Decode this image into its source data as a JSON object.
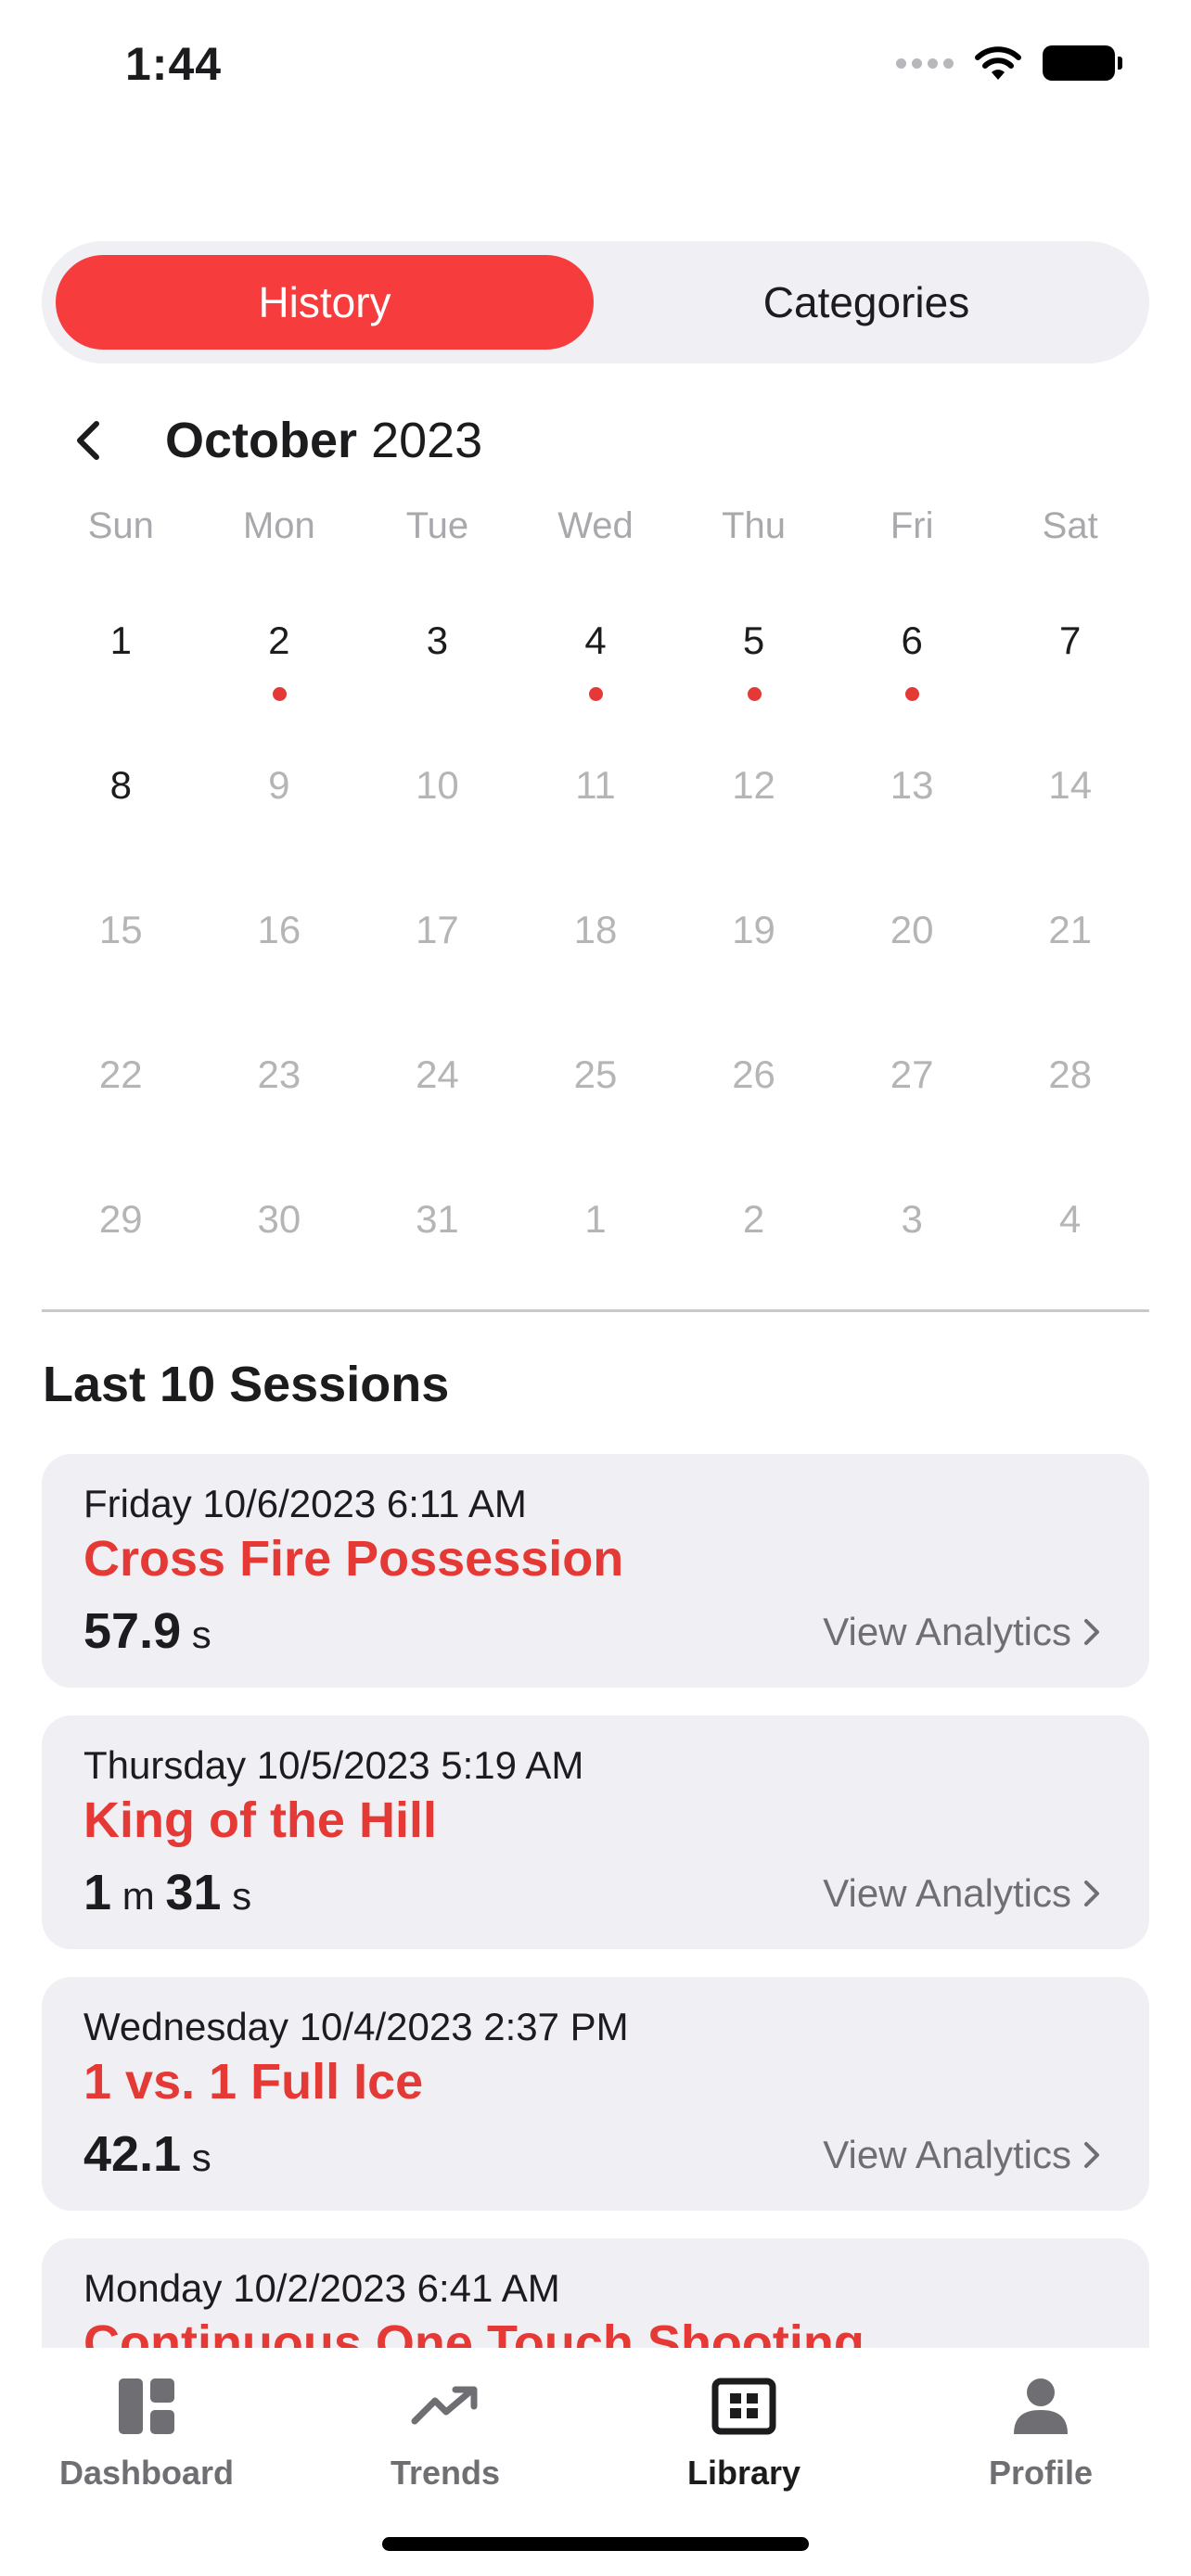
{
  "status_bar": {
    "time": "1:44"
  },
  "segmented": {
    "history_label": "History",
    "categories_label": "Categories",
    "selected": "History"
  },
  "calendar": {
    "month": "October",
    "year": "2023",
    "weekdays": [
      "Sun",
      "Mon",
      "Tue",
      "Wed",
      "Thu",
      "Fri",
      "Sat"
    ],
    "weeks": [
      [
        {
          "d": "1",
          "muted": false,
          "dot": false
        },
        {
          "d": "2",
          "muted": false,
          "dot": true
        },
        {
          "d": "3",
          "muted": false,
          "dot": false
        },
        {
          "d": "4",
          "muted": false,
          "dot": true
        },
        {
          "d": "5",
          "muted": false,
          "dot": true
        },
        {
          "d": "6",
          "muted": false,
          "dot": true
        },
        {
          "d": "7",
          "muted": false,
          "dot": false
        }
      ],
      [
        {
          "d": "8",
          "muted": false,
          "dot": false
        },
        {
          "d": "9",
          "muted": true,
          "dot": false
        },
        {
          "d": "10",
          "muted": true,
          "dot": false
        },
        {
          "d": "11",
          "muted": true,
          "dot": false
        },
        {
          "d": "12",
          "muted": true,
          "dot": false
        },
        {
          "d": "13",
          "muted": true,
          "dot": false
        },
        {
          "d": "14",
          "muted": true,
          "dot": false
        }
      ],
      [
        {
          "d": "15",
          "muted": true,
          "dot": false
        },
        {
          "d": "16",
          "muted": true,
          "dot": false
        },
        {
          "d": "17",
          "muted": true,
          "dot": false
        },
        {
          "d": "18",
          "muted": true,
          "dot": false
        },
        {
          "d": "19",
          "muted": true,
          "dot": false
        },
        {
          "d": "20",
          "muted": true,
          "dot": false
        },
        {
          "d": "21",
          "muted": true,
          "dot": false
        }
      ],
      [
        {
          "d": "22",
          "muted": true,
          "dot": false
        },
        {
          "d": "23",
          "muted": true,
          "dot": false
        },
        {
          "d": "24",
          "muted": true,
          "dot": false
        },
        {
          "d": "25",
          "muted": true,
          "dot": false
        },
        {
          "d": "26",
          "muted": true,
          "dot": false
        },
        {
          "d": "27",
          "muted": true,
          "dot": false
        },
        {
          "d": "28",
          "muted": true,
          "dot": false
        }
      ],
      [
        {
          "d": "29",
          "muted": true,
          "dot": false
        },
        {
          "d": "30",
          "muted": true,
          "dot": false
        },
        {
          "d": "31",
          "muted": true,
          "dot": false
        },
        {
          "d": "1",
          "muted": true,
          "dot": false
        },
        {
          "d": "2",
          "muted": true,
          "dot": false
        },
        {
          "d": "3",
          "muted": true,
          "dot": false
        },
        {
          "d": "4",
          "muted": true,
          "dot": false
        }
      ]
    ]
  },
  "sessions": {
    "title": "Last 10 Sessions",
    "view_analytics_label": "View Analytics",
    "items": [
      {
        "date": "Friday 10/6/2023 6:11 AM",
        "name": "Cross Fire Possession",
        "duration": [
          {
            "v": "57.9",
            "u": "s"
          }
        ]
      },
      {
        "date": "Thursday 10/5/2023 5:19 AM",
        "name": "King of the Hill",
        "duration": [
          {
            "v": "1",
            "u": "m"
          },
          {
            "v": "31",
            "u": "s"
          }
        ]
      },
      {
        "date": "Wednesday 10/4/2023 2:37 PM",
        "name": "1 vs. 1 Full Ice",
        "duration": [
          {
            "v": "42.1",
            "u": "s"
          }
        ]
      },
      {
        "date": "Monday 10/2/2023 6:41 AM",
        "name": "Continuous One Touch Shooting",
        "duration": []
      }
    ]
  },
  "tab_bar": {
    "tabs": [
      {
        "label": "Dashboard",
        "icon": "dashboard-icon",
        "active": false
      },
      {
        "label": "Trends",
        "icon": "trending-up-icon",
        "active": false
      },
      {
        "label": "Library",
        "icon": "library-grid-icon",
        "active": true
      },
      {
        "label": "Profile",
        "icon": "person-icon",
        "active": false
      }
    ]
  },
  "colors": {
    "accent": "#f63c3c",
    "session_name": "#e53935",
    "card_bg": "#efeff4",
    "muted_text": "#b5b5b8"
  }
}
